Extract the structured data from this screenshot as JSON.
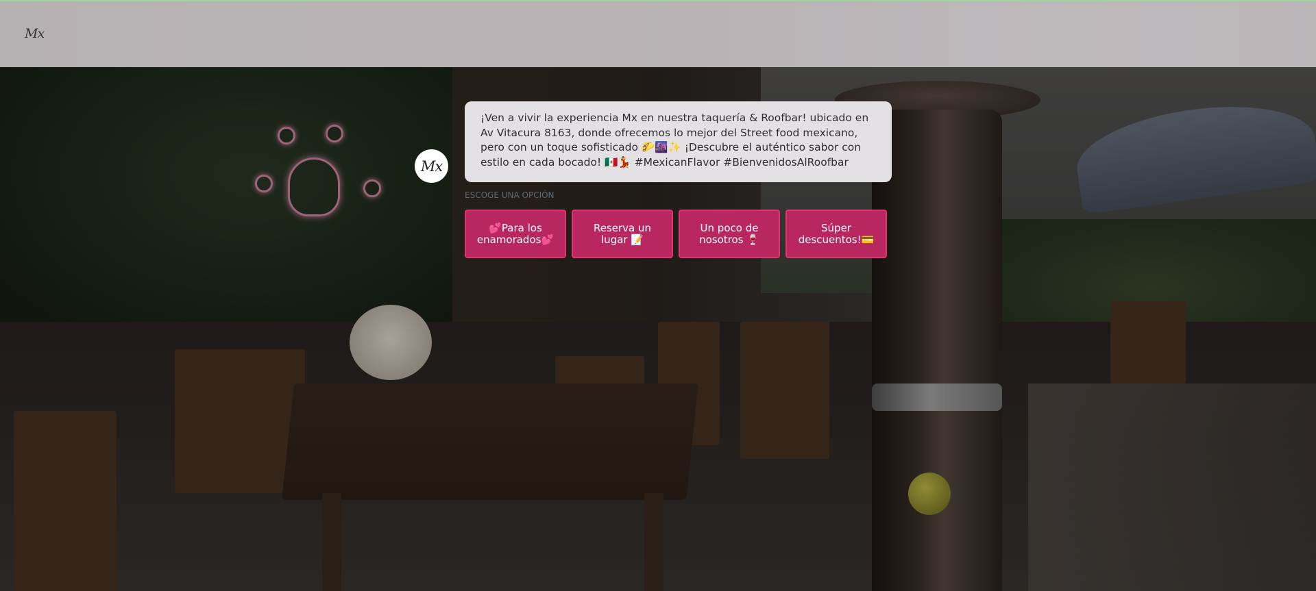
{
  "header": {
    "logo_text": "Mx"
  },
  "chat": {
    "avatar_text": "Mx",
    "message": "¡Ven a vivir la experiencia Mx en nuestra taquería & Roofbar! ubicado en Av Vitacura 8163, donde ofrecemos lo mejor del Street food mexicano, pero con un toque sofisticado 🌮🌆✨ ¡Descubre el auténtico sabor con estilo en cada bocado! 🇲🇽💃 #MexicanFlavor #BienvenidosAlRoofbar",
    "prompt": "Escoge una opción",
    "options": [
      {
        "label": "💕Para los enamorados💕"
      },
      {
        "label": "Reserva un lugar 📝"
      },
      {
        "label": "Un poco de nosotros 🍷"
      },
      {
        "label": "Súper descuentos!💳"
      }
    ]
  },
  "colors": {
    "button_bg": "#b8275f",
    "button_border": "#e2326f",
    "header_bg": "#e4dee2",
    "bubble_bg": "#e4e1e4"
  }
}
